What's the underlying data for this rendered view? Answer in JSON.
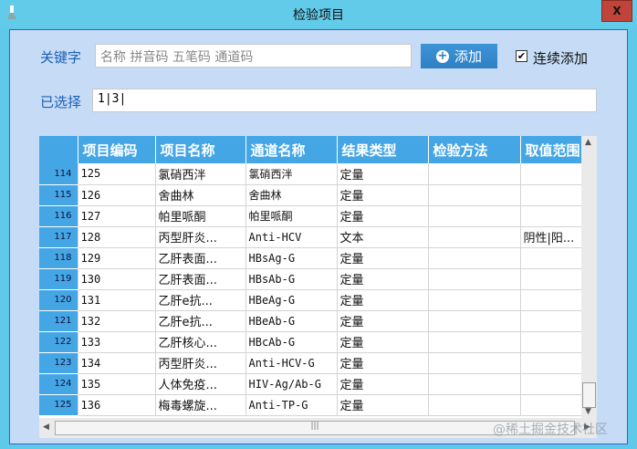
{
  "window": {
    "title": "检验项目",
    "close_label": "X"
  },
  "search": {
    "label": "关键字",
    "placeholder": "名称 拼音码 五笔码 通道码",
    "add_label": "添加",
    "continuous_label": "连续添加",
    "continuous_checked": true
  },
  "selected": {
    "label": "已选择",
    "value": "1|3|"
  },
  "table": {
    "headers": [
      "项目编码",
      "项目名称",
      "通道名称",
      "结果类型",
      "检验方法",
      "取值范围"
    ],
    "rows": [
      {
        "n": "114",
        "c": [
          "125",
          "氯硝西泮",
          "氯硝西泮",
          "定量",
          "",
          ""
        ]
      },
      {
        "n": "115",
        "c": [
          "126",
          "舍曲林",
          "舍曲林",
          "定量",
          "",
          ""
        ]
      },
      {
        "n": "116",
        "c": [
          "127",
          "帕里哌酮",
          "帕里哌酮",
          "定量",
          "",
          ""
        ]
      },
      {
        "n": "117",
        "c": [
          "128",
          "丙型肝炎...",
          "Anti-HCV",
          "文本",
          "",
          "阴性|阳..."
        ]
      },
      {
        "n": "118",
        "c": [
          "129",
          "乙肝表面...",
          "HBsAg-G",
          "定量",
          "",
          ""
        ]
      },
      {
        "n": "119",
        "c": [
          "130",
          "乙肝表面...",
          "HBsAb-G",
          "定量",
          "",
          ""
        ]
      },
      {
        "n": "120",
        "c": [
          "131",
          "乙肝e抗...",
          "HBeAg-G",
          "定量",
          "",
          ""
        ]
      },
      {
        "n": "121",
        "c": [
          "132",
          "乙肝e抗...",
          "HBeAb-G",
          "定量",
          "",
          ""
        ]
      },
      {
        "n": "122",
        "c": [
          "133",
          "乙肝核心...",
          "HBcAb-G",
          "定量",
          "",
          ""
        ]
      },
      {
        "n": "123",
        "c": [
          "134",
          "丙型肝炎...",
          "Anti-HCV-G",
          "定量",
          "",
          ""
        ]
      },
      {
        "n": "124",
        "c": [
          "135",
          "人体免疫...",
          "HIV-Ag/Ab-G",
          "定量",
          "",
          ""
        ]
      },
      {
        "n": "125",
        "c": [
          "136",
          "梅毒螺旋...",
          "Anti-TP-G",
          "定量",
          "",
          ""
        ]
      }
    ]
  },
  "watermark": "@稀土掘金技术社区"
}
